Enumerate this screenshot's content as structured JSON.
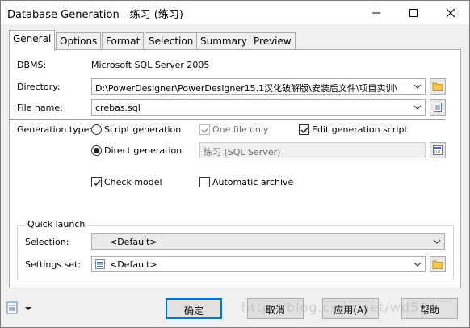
{
  "window": {
    "title": "Database Generation - 练习 (练习)"
  },
  "tabs": [
    {
      "label": "General",
      "active": true
    },
    {
      "label": "Options"
    },
    {
      "label": "Format"
    },
    {
      "label": "Selection"
    },
    {
      "label": "Summary"
    },
    {
      "label": "Preview"
    }
  ],
  "general": {
    "dbms_label": "DBMS:",
    "dbms_value": "Microsoft SQL Server 2005",
    "directory_label": "Directory:",
    "directory_value": "D:\\PowerDesigner\\PowerDesigner15.1汉化破解版\\安装后文件\\项目实训\\",
    "file_name_label": "File name:",
    "file_name_value": "crebas.sql",
    "generation_type_label": "Generation type:",
    "script_generation_label": "Script generation",
    "one_file_only_label": "One file only",
    "edit_generation_script_label": "Edit generation script",
    "direct_generation_label": "Direct generation",
    "data_source_value": "练习 (SQL Server)",
    "check_model_label": "Check model",
    "automatic_archive_label": "Automatic archive"
  },
  "quick_launch": {
    "title": "Quick launch",
    "selection_label": "Selection:",
    "selection_value": "<Default>",
    "settings_label": "Settings set:",
    "settings_value": "<Default>"
  },
  "footer": {
    "ok": "确定",
    "cancel": "取消",
    "apply": "应用(A)",
    "help": "帮助"
  },
  "watermark": "http://blog.csdn.net/wd524"
}
